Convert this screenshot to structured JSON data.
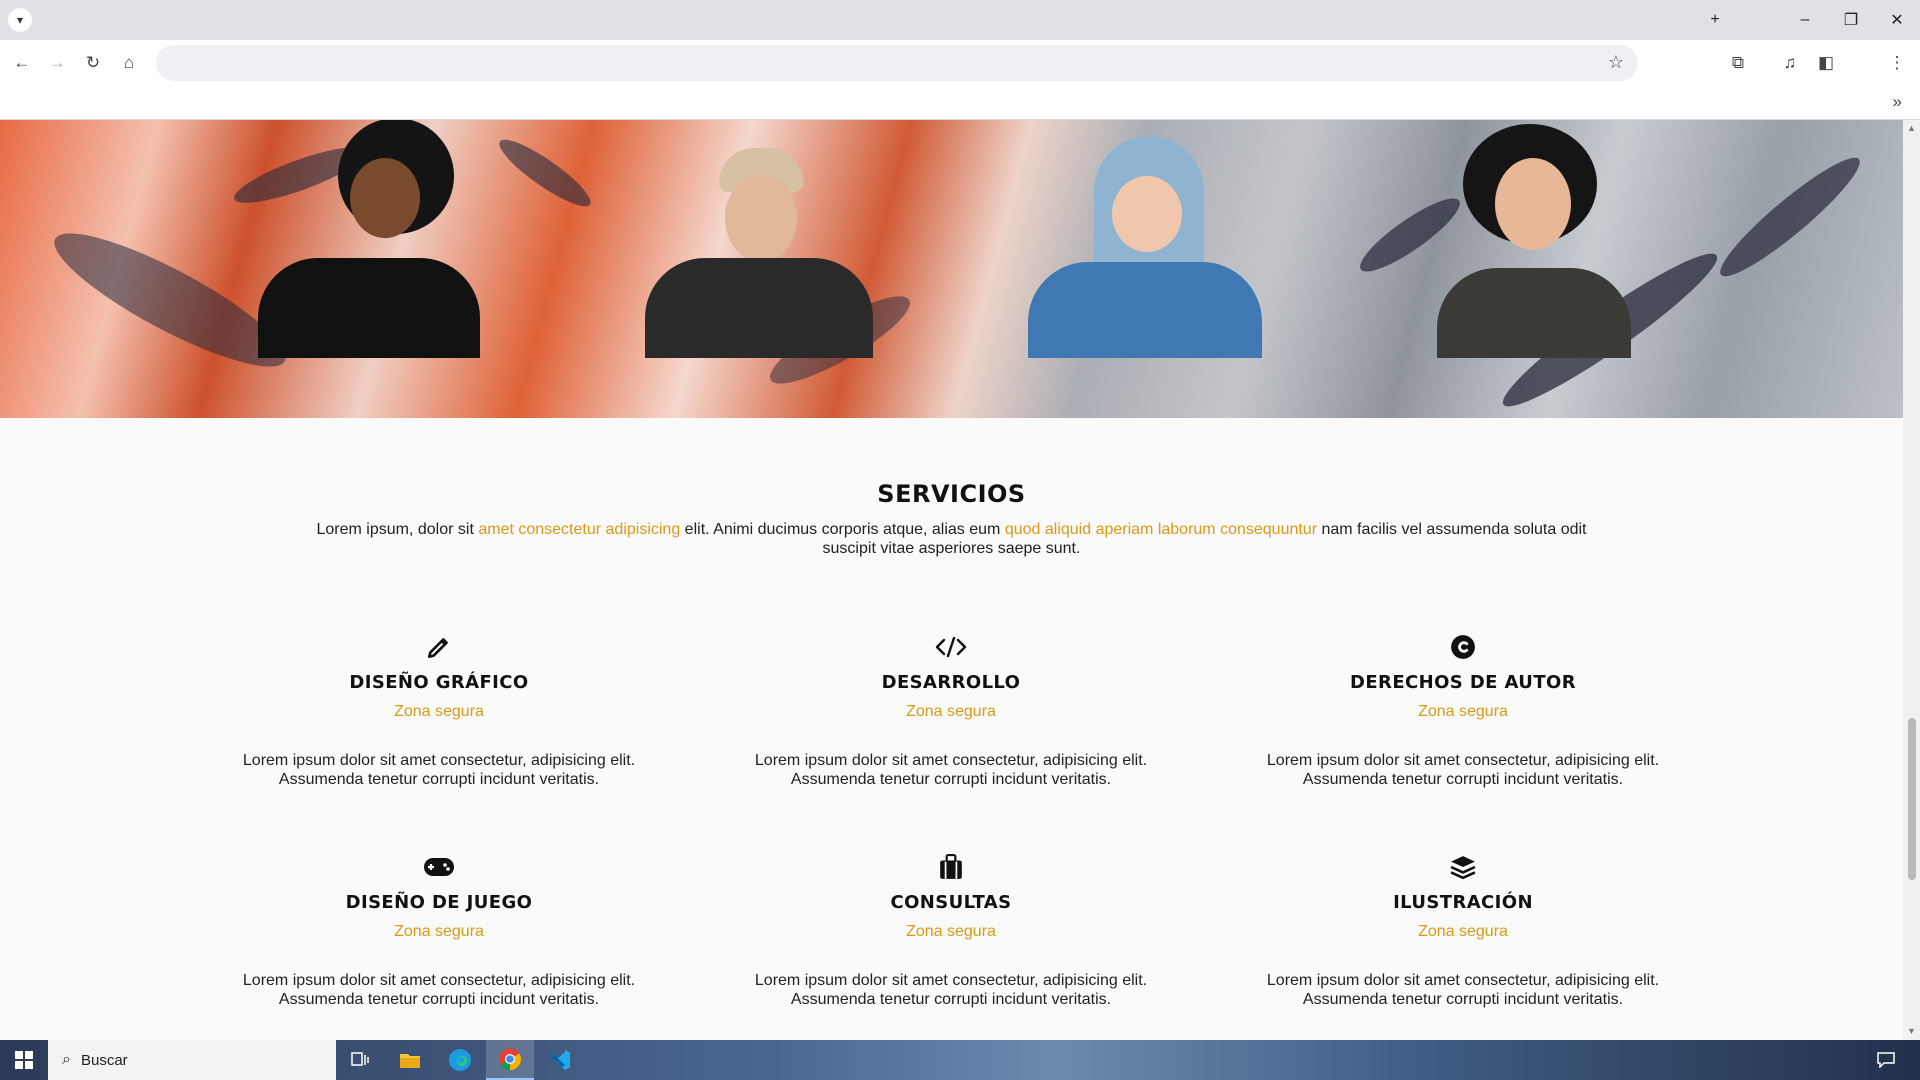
{
  "browser": {
    "tab_menu_icon": "chevron-down-icon",
    "new_tab_symbol": "+",
    "minimize_symbol": "–",
    "restore_symbol": "❐",
    "close_symbol": "✕",
    "back_symbol": "←",
    "forward_symbol": "→",
    "reload_symbol": "↻",
    "home_symbol": "⌂",
    "bookmark_symbol": "☆",
    "extensions_symbol": "⧉",
    "menu_symbol": "⋮",
    "overflow_symbol": "»",
    "address_value": ""
  },
  "services": {
    "title": "SERVICIOS",
    "intro_part1": "Lorem ipsum, dolor sit ",
    "intro_link1": "amet consectetur adipisicing",
    "intro_part2": " elit. Animi ducimus corporis atque, alias eum ",
    "intro_link2": "quod aliquid aperiam laborum consequuntur",
    "intro_part3": " nam facilis vel assumenda soluta odit suscipit vitae asperiores saepe sunt.",
    "accent_color": "#d99a17",
    "items": [
      {
        "icon": "pencil-icon",
        "glyph": "✎",
        "title": "DISEÑO GRÁFICO",
        "subtitle": "Zona segura",
        "text": "Lorem ipsum dolor sit amet consectetur, adipisicing elit. Assumenda tenetur corrupti incidunt veritatis."
      },
      {
        "icon": "code-icon",
        "glyph": "</>",
        "title": "DESARROLLO",
        "subtitle": "Zona segura",
        "text": "Lorem ipsum dolor sit amet consectetur, adipisicing elit. Assumenda tenetur corrupti incidunt veritatis."
      },
      {
        "icon": "copyright-icon",
        "glyph": "C",
        "title": "DERECHOS DE AUTOR",
        "subtitle": "Zona segura",
        "text": "Lorem ipsum dolor sit amet consectetur, adipisicing elit. Assumenda tenetur corrupti incidunt veritatis."
      },
      {
        "icon": "gamepad-icon",
        "glyph": "⊕",
        "title": "DISEÑO DE JUEGO",
        "subtitle": "Zona segura",
        "text": "Lorem ipsum dolor sit amet consectetur, adipisicing elit. Assumenda tenetur corrupti incidunt veritatis."
      },
      {
        "icon": "briefcase-icon",
        "glyph": "▣",
        "title": "CONSULTAS",
        "subtitle": "Zona segura",
        "text": "Lorem ipsum dolor sit amet consectetur, adipisicing elit. Assumenda tenetur corrupti incidunt veritatis."
      },
      {
        "icon": "layers-icon",
        "glyph": "≋",
        "title": "ILUSTRACIÓN",
        "subtitle": "Zona segura",
        "text": "Lorem ipsum dolor sit amet consectetur, adipisicing elit. Assumenda tenetur corrupti incidunt veritatis."
      }
    ]
  },
  "taskbar": {
    "search_placeholder": "Buscar",
    "apps": [
      "task-view-icon",
      "file-explorer-icon",
      "edge-icon",
      "chrome-icon",
      "vscode-icon"
    ],
    "notification_icon": "notification-icon"
  }
}
